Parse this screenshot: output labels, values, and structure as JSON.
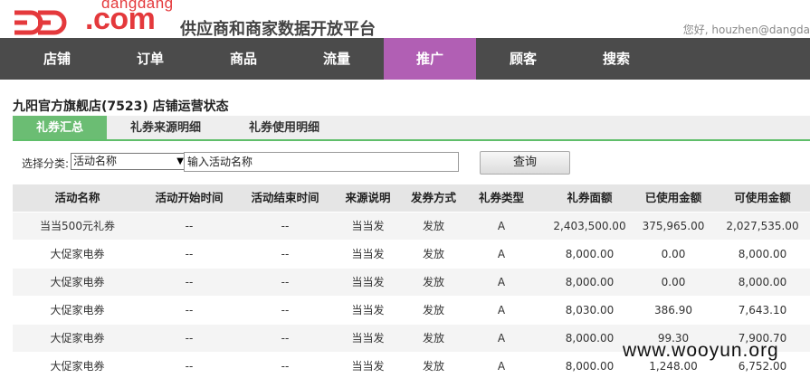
{
  "header": {
    "logo_small": "dangdang",
    "logo_dotcom": ".com",
    "platform_title": "供应商和商家数据开放平台",
    "greeting": "您好, houzhen@dangda"
  },
  "nav": {
    "items": [
      {
        "label": "店铺"
      },
      {
        "label": "订单"
      },
      {
        "label": "商品"
      },
      {
        "label": "流量"
      },
      {
        "label": "推广"
      },
      {
        "label": "顾客"
      },
      {
        "label": "搜索"
      }
    ],
    "active_index": 4,
    "active_color": "#b15fb4"
  },
  "store_title": "九阳官方旗舰店(7523) 店铺运营状态",
  "tabs": [
    {
      "label": "礼券汇总"
    },
    {
      "label": "礼券来源明细"
    },
    {
      "label": "礼券使用明细"
    }
  ],
  "filter": {
    "label": "选择分类:",
    "selected": "活动名称",
    "input_value": "输入活动名称",
    "query_label": "查询"
  },
  "table": {
    "headers": [
      "活动名称",
      "活动开始时间",
      "活动结束时间",
      "来源说明",
      "发券方式",
      "礼券类型",
      "礼券面额",
      "已使用金额",
      "可使用金额"
    ],
    "rows": [
      [
        "当当500元礼券",
        "--",
        "--",
        "当当发",
        "发放",
        "A",
        "2,403,500.00",
        "375,965.00",
        "2,027,535.00"
      ],
      [
        "大促家电券",
        "--",
        "--",
        "当当发",
        "发放",
        "A",
        "8,000.00",
        "0.00",
        "8,000.00"
      ],
      [
        "大促家电券",
        "--",
        "--",
        "当当发",
        "发放",
        "A",
        "8,000.00",
        "0.00",
        "8,000.00"
      ],
      [
        "大促家电券",
        "--",
        "--",
        "当当发",
        "发放",
        "A",
        "8,030.00",
        "386.90",
        "7,643.10"
      ],
      [
        "大促家电券",
        "--",
        "--",
        "当当发",
        "发放",
        "A",
        "8,000.00",
        "99.30",
        "7,900.70"
      ],
      [
        "大促家电券",
        "--",
        "--",
        "当当发",
        "发放",
        "A",
        "8,000.00",
        "1,248.00",
        "6,752.00"
      ]
    ]
  },
  "watermark": "www.wooyun.org",
  "colors": {
    "brand": "#e4393c",
    "nav_bg": "#4b4b4b",
    "tab_active": "#6bbd73"
  }
}
